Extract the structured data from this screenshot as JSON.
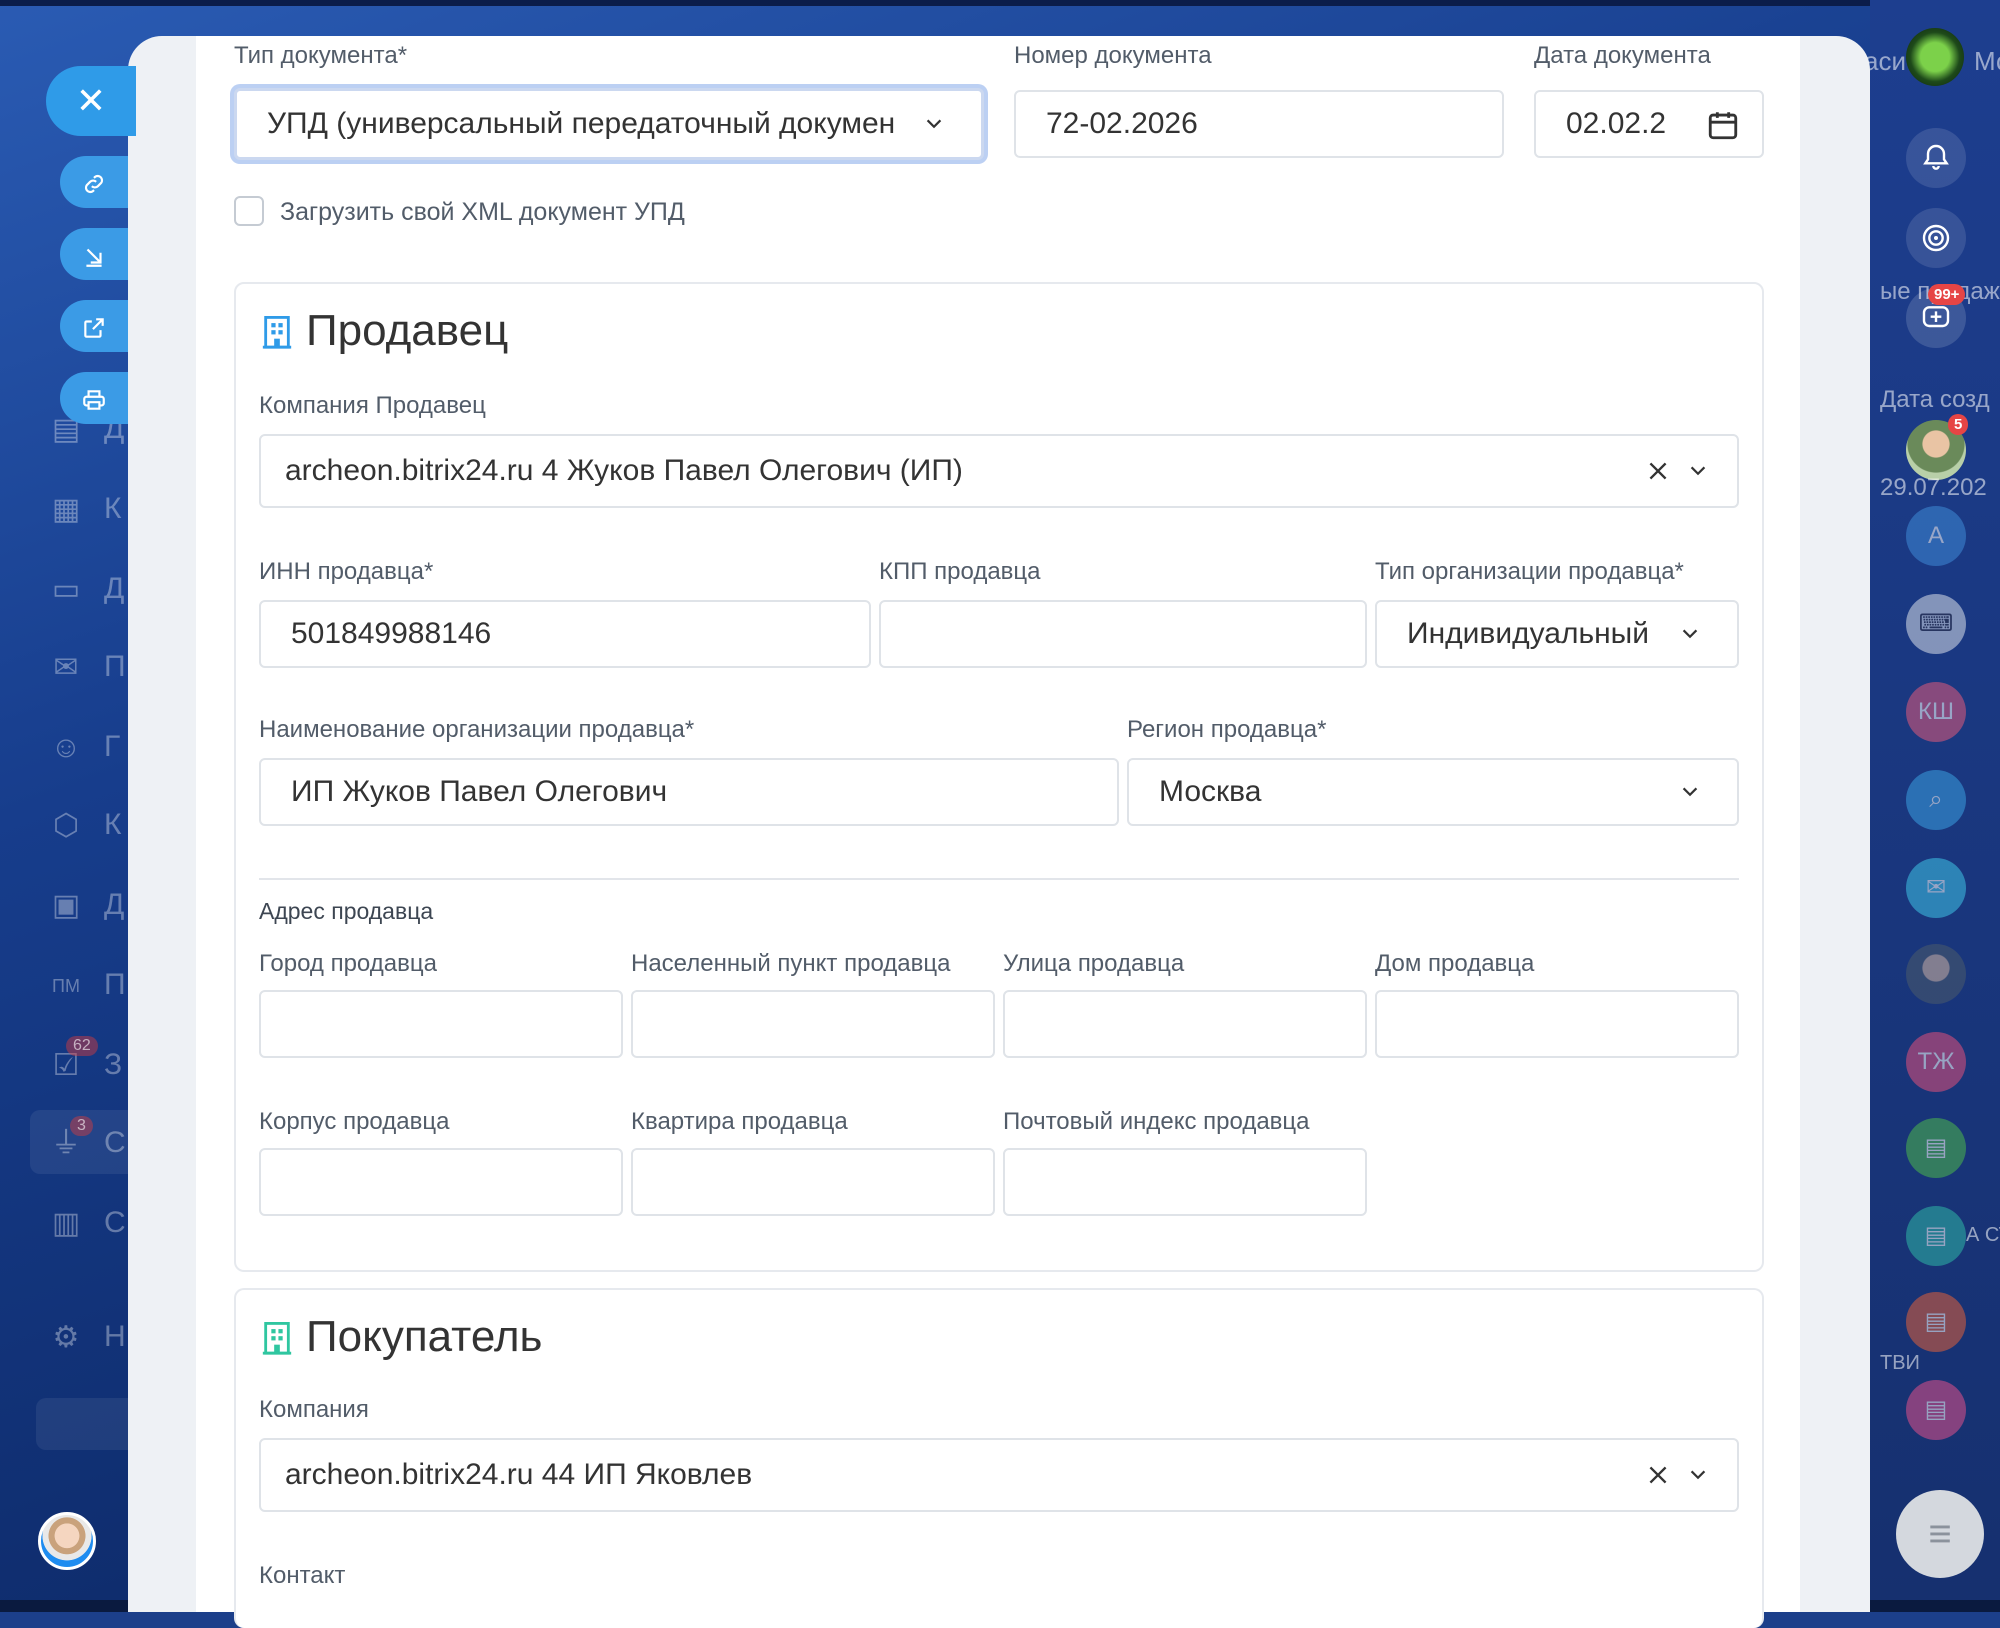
{
  "background": {
    "left_badges": [
      "62",
      "3"
    ],
    "left_menu_letters": [
      "Д",
      "К",
      "Д",
      "П",
      "Г",
      "К",
      "Д",
      "П",
      "З",
      "С",
      "С",
      "Н"
    ],
    "pm_label": "ПМ"
  },
  "right_sidebar": {
    "top_text": "асит",
    "top_text2": "Мс",
    "sales_text": "ые продажи",
    "badge_99": "99+",
    "date_header": "Дата созд",
    "date_value": "29.07.202",
    "avatar_badge": "5",
    "avatar_a": "А",
    "avatar_ksh": "КШ",
    "avatar_tzh": "ТЖ",
    "chat_name": "ТВИ",
    "chat_text": "А СТ"
  },
  "form": {
    "doc_type_label": "Тип документа*",
    "doc_type_value": "УПД (универсальный передаточный докумен",
    "doc_number_label": "Номер документа",
    "doc_number_value": "72-02.2026",
    "doc_date_label": "Дата документа",
    "doc_date_value": "02.02.2",
    "upload_xml_label": "Загрузить свой XML документ УПД"
  },
  "seller": {
    "title": "Продавец",
    "company_label": "Компания Продавец",
    "company_value": "archeon.bitrix24.ru 4 Жуков Павел Олегович (ИП)",
    "inn_label": "ИНН продавца*",
    "inn_value": "501849988146",
    "kpp_label": "КПП продавца",
    "kpp_value": "",
    "org_type_label": "Тип организации продавца*",
    "org_type_value": "Индивидуальный",
    "org_name_label": "Наименование организации продавца*",
    "org_name_value": "ИП Жуков Павел Олегович",
    "region_label": "Регион продавца*",
    "region_value": "Москва",
    "address_heading": "Адрес продавца",
    "city_label": "Город продавца",
    "locality_label": "Населенный пункт продавца",
    "street_label": "Улица продавца",
    "house_label": "Дом продавца",
    "building_label": "Корпус продавца",
    "apartment_label": "Квартира продавца",
    "postcode_label": "Почтовый индекс продавца"
  },
  "buyer": {
    "title": "Покупатель",
    "company_label": "Компания",
    "company_value": "archeon.bitrix24.ru 44 ИП Яковлев",
    "contact_label": "Контакт"
  },
  "colors": {
    "accent": "#2f9be8",
    "seller_icon": "#2f9be8",
    "buyer_icon": "#2fc6a0"
  }
}
